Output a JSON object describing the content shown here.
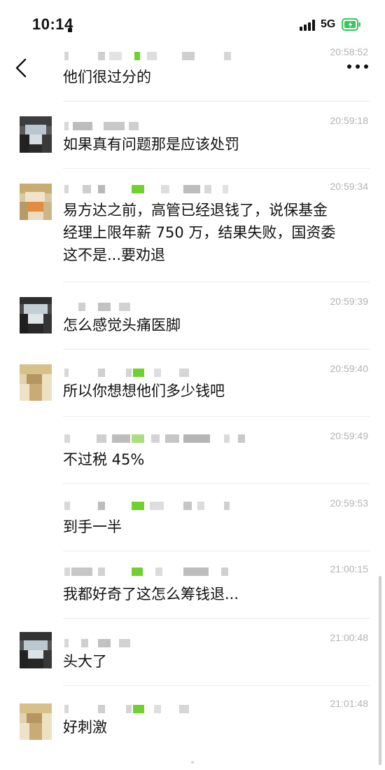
{
  "status_bar": {
    "time": "10:14",
    "network": "5G",
    "battery_color": "#34c759"
  },
  "nav": {
    "back_icon": "chevron-left-icon",
    "more_icon": "more-dots-icon"
  },
  "colors": {
    "timestamp": "#b3b3b3",
    "text": "#111111",
    "separator": "#ebebeb",
    "pixel_green": "#6ed12e"
  },
  "messages": [
    {
      "time": "20:58:52",
      "lines": [
        "他们很过分的"
      ]
    },
    {
      "time": "20:59:18",
      "lines": [
        "如果真有问题那是应该处罚"
      ]
    },
    {
      "time": "20:59:34",
      "lines": [
        "易方达之前，高管已经退钱了，说保基金",
        "经理上限年薪 750 万，结果失败，国资委",
        "这不是...要劝退"
      ]
    },
    {
      "time": "20:59:39",
      "lines": [
        "怎么感觉头痛医脚"
      ]
    },
    {
      "time": "20:59:40",
      "lines": [
        "所以你想想他们多少钱吧"
      ]
    },
    {
      "time": "20:59:49",
      "lines": [
        "不过税 45%"
      ]
    },
    {
      "time": "20:59:53",
      "lines": [
        "到手一半"
      ]
    },
    {
      "time": "21:00:15",
      "lines": [
        "我都好奇了这怎么筹钱退..."
      ]
    },
    {
      "time": "21:00:48",
      "lines": [
        "头大了"
      ]
    },
    {
      "time": "21:01:48",
      "lines": [
        "好刺激"
      ]
    }
  ]
}
